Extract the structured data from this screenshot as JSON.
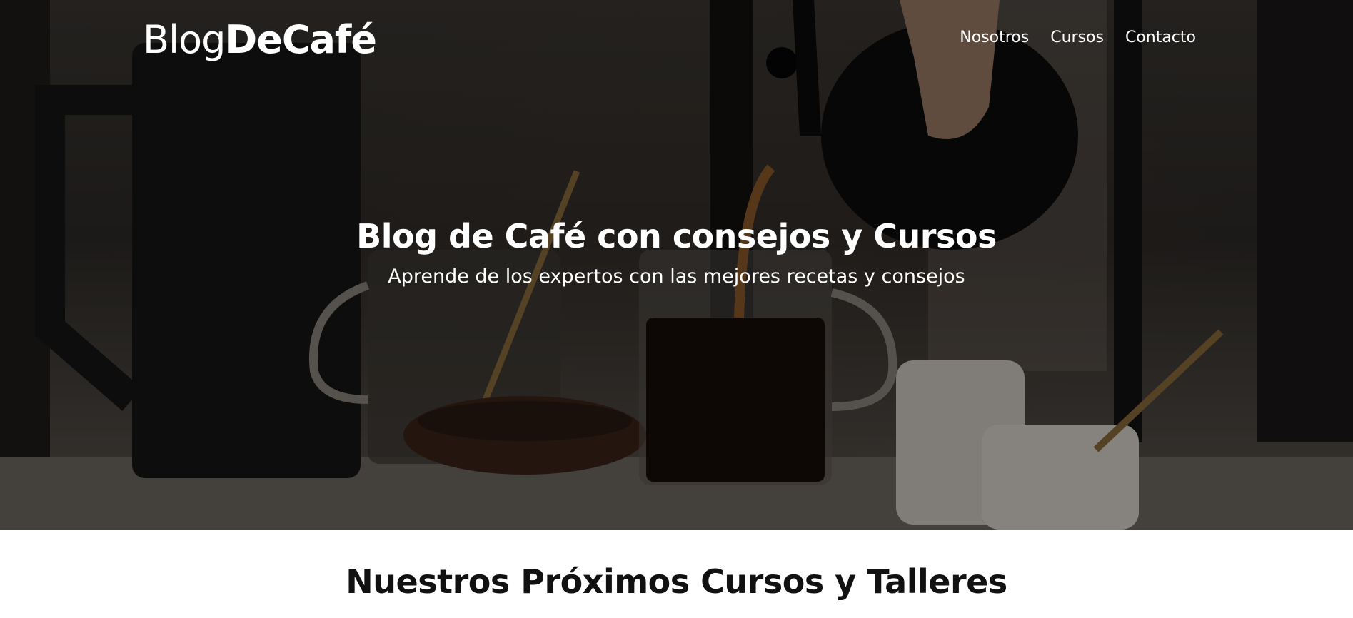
{
  "header": {
    "logo_light": "Blog",
    "logo_bold": "DeCafé",
    "nav": [
      {
        "label": "Nosotros"
      },
      {
        "label": "Cursos"
      },
      {
        "label": "Contacto"
      }
    ]
  },
  "hero": {
    "title": "Blog de Café con consejos y Cursos",
    "subtitle": "Aprende de los expertos con las mejores recetas y consejos",
    "image": "coffee-pouring-photo"
  },
  "courses": {
    "title": "Nuestros Próximos Cursos y Talleres"
  },
  "colors": {
    "text_light": "#ffffff",
    "text_dark": "#111111",
    "hero_overlay": "rgba(0,0,0,0.38)"
  }
}
